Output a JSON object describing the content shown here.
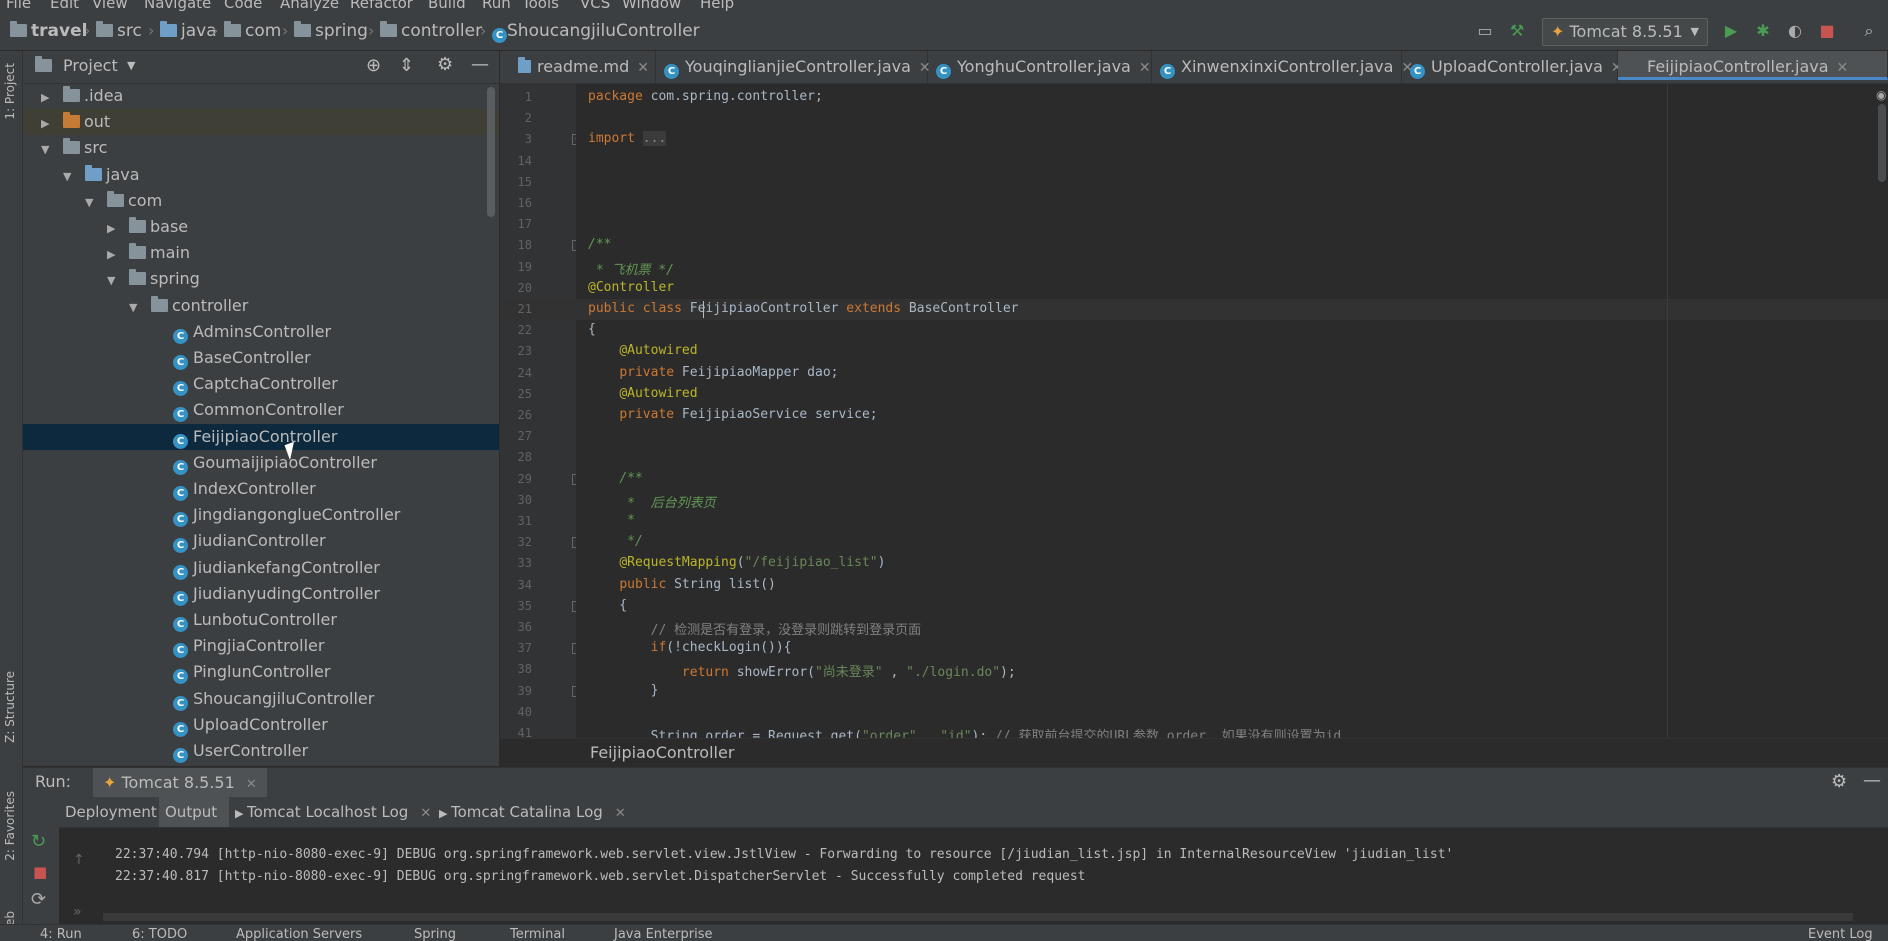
{
  "menu": [
    "File",
    "Edit",
    "View",
    "Navigate",
    "Code",
    "Analyze",
    "Refactor",
    "Build",
    "Run",
    "Tools",
    "VCS",
    "Window",
    "Help"
  ],
  "breadcrumbs": [
    "travel",
    "src",
    "java",
    "com",
    "spring",
    "controller",
    "ShoucangjiluController"
  ],
  "run_config": "Tomcat 8.5.51",
  "left_stripe": {
    "project": "1: Project",
    "structure": "Z: Structure",
    "favorites": "2: Favorites",
    "web": "Web"
  },
  "project_panel": {
    "title": "Project",
    "tree": [
      {
        "label": ".idea",
        "type": "folder",
        "depth": 1,
        "arrow": "▶"
      },
      {
        "label": "out",
        "type": "folder-orange",
        "depth": 1,
        "arrow": "▶"
      },
      {
        "label": "src",
        "type": "folder",
        "depth": 1,
        "arrow": "▼"
      },
      {
        "label": "java",
        "type": "folder-blue",
        "depth": 2,
        "arrow": "▼"
      },
      {
        "label": "com",
        "type": "package",
        "depth": 3,
        "arrow": "▼"
      },
      {
        "label": "base",
        "type": "package",
        "depth": 4,
        "arrow": "▶"
      },
      {
        "label": "main",
        "type": "package",
        "depth": 4,
        "arrow": "▶"
      },
      {
        "label": "spring",
        "type": "package",
        "depth": 4,
        "arrow": "▼"
      },
      {
        "label": "controller",
        "type": "package",
        "depth": 5,
        "arrow": "▼"
      },
      {
        "label": "AdminsController",
        "type": "class",
        "depth": 6
      },
      {
        "label": "BaseController",
        "type": "class",
        "depth": 6
      },
      {
        "label": "CaptchaController",
        "type": "class",
        "depth": 6
      },
      {
        "label": "CommonController",
        "type": "class",
        "depth": 6
      },
      {
        "label": "FeijipiaoController",
        "type": "class",
        "depth": 6,
        "selected": true
      },
      {
        "label": "GoumaijipiaoController",
        "type": "class",
        "depth": 6
      },
      {
        "label": "IndexController",
        "type": "class",
        "depth": 6
      },
      {
        "label": "JingdiangonglueController",
        "type": "class",
        "depth": 6
      },
      {
        "label": "JiudianController",
        "type": "class",
        "depth": 6
      },
      {
        "label": "JiudiankefangController",
        "type": "class",
        "depth": 6
      },
      {
        "label": "JiudianyudingController",
        "type": "class",
        "depth": 6
      },
      {
        "label": "LunbotuController",
        "type": "class",
        "depth": 6
      },
      {
        "label": "PingjiaController",
        "type": "class",
        "depth": 6
      },
      {
        "label": "PinglunController",
        "type": "class",
        "depth": 6
      },
      {
        "label": "ShoucangjiluController",
        "type": "class",
        "depth": 6
      },
      {
        "label": "UploadController",
        "type": "class",
        "depth": 6
      },
      {
        "label": "UserController",
        "type": "class",
        "depth": 6
      }
    ]
  },
  "editor_tabs": [
    {
      "label": "readme.md",
      "icon": "markdown"
    },
    {
      "label": "YouqinglianjieController.java",
      "icon": "class"
    },
    {
      "label": "YonghuController.java",
      "icon": "class"
    },
    {
      "label": "XinwenxinxiController.java",
      "icon": "class"
    },
    {
      "label": "UploadController.java",
      "icon": "class"
    },
    {
      "label": "FeijipiaoController.java",
      "icon": "class",
      "active": true
    }
  ],
  "code_lines": [
    {
      "n": "1",
      "html": "<span class='kw'>package</span> com.spring.controller;"
    },
    {
      "n": "2",
      "html": ""
    },
    {
      "n": "3",
      "html": "<span class='kw'>import</span> <span style='background:#3b3b3b;color:#888'>...</span>"
    },
    {
      "n": "14",
      "html": ""
    },
    {
      "n": "15",
      "html": ""
    },
    {
      "n": "16",
      "html": ""
    },
    {
      "n": "17",
      "html": ""
    },
    {
      "n": "18",
      "html": "<span class='dc'>/**</span>"
    },
    {
      "n": "19",
      "html": "<span class='dc'> * 飞机票 */</span>"
    },
    {
      "n": "20",
      "html": "<span class='an'>@Controller</span>"
    },
    {
      "n": "21",
      "html": "<span class='kw'>public class</span> FeijipiaoController <span class='kw'>extends</span> BaseController"
    },
    {
      "n": "22",
      "html": "{"
    },
    {
      "n": "23",
      "html": "    <span class='an'>@Autowired</span>"
    },
    {
      "n": "24",
      "html": "    <span class='kw'>private</span> FeijipiaoMapper dao;"
    },
    {
      "n": "25",
      "html": "    <span class='an'>@Autowired</span>"
    },
    {
      "n": "26",
      "html": "    <span class='kw'>private</span> FeijipiaoService service;"
    },
    {
      "n": "27",
      "html": ""
    },
    {
      "n": "28",
      "html": ""
    },
    {
      "n": "29",
      "html": "    <span class='dc'>/**</span>"
    },
    {
      "n": "30",
      "html": "    <span class='dc'> *  后台列表页</span>"
    },
    {
      "n": "31",
      "html": "    <span class='dc'> *</span>"
    },
    {
      "n": "32",
      "html": "    <span class='dc'> */</span>"
    },
    {
      "n": "33",
      "html": "    <span class='an'>@RequestMapping</span>(<span class='str'>\"/feijipiao_list\"</span>)"
    },
    {
      "n": "34",
      "html": "    <span class='kw'>public</span> String list()"
    },
    {
      "n": "35",
      "html": "    {"
    },
    {
      "n": "36",
      "html": "        <span class='cm'>// 检测是否有登录，没登录则跳转到登录页面</span>"
    },
    {
      "n": "37",
      "html": "        <span class='kw'>if</span>(!checkLogin()){"
    },
    {
      "n": "38",
      "html": "            <span class='kw'>return</span> showError(<span class='str'>\"尚未登录\"</span> , <span class='str'>\"./login.do\"</span>);"
    },
    {
      "n": "39",
      "html": "        }"
    },
    {
      "n": "40",
      "html": ""
    },
    {
      "n": "41",
      "html": "        String order = Request.get(<span class='str'>\"order\"</span> , <span class='str'>\"id\"</span>); <span class='cm'>// 获取前台提交的URL参数 order  如果没有则设置为id</span>"
    }
  ],
  "editor_breadcrumb": "FeijipiaoController",
  "run_panel": {
    "label": "Run:",
    "config_tab": "Tomcat 8.5.51",
    "tabs": [
      "Deployment",
      "Output",
      "Tomcat Localhost Log",
      "Tomcat Catalina Log"
    ],
    "log": [
      "22:37:40.794 [http-nio-8080-exec-9] DEBUG org.springframework.web.servlet.view.JstlView - Forwarding to resource [/jiudian_list.jsp] in InternalResourceView 'jiudian_list'",
      "22:37:40.817 [http-nio-8080-exec-9] DEBUG org.springframework.web.servlet.DispatcherServlet - Successfully completed request"
    ]
  },
  "bottom_tabs": [
    "4: Run",
    "6: TODO",
    "Application Servers",
    "Spring",
    "Terminal",
    "Java Enterprise"
  ],
  "event_log": "Event Log",
  "colors": {
    "accent": "#4a88c7",
    "selection": "#0d293e",
    "run_green": "#499c54",
    "stop_red": "#c75450"
  }
}
